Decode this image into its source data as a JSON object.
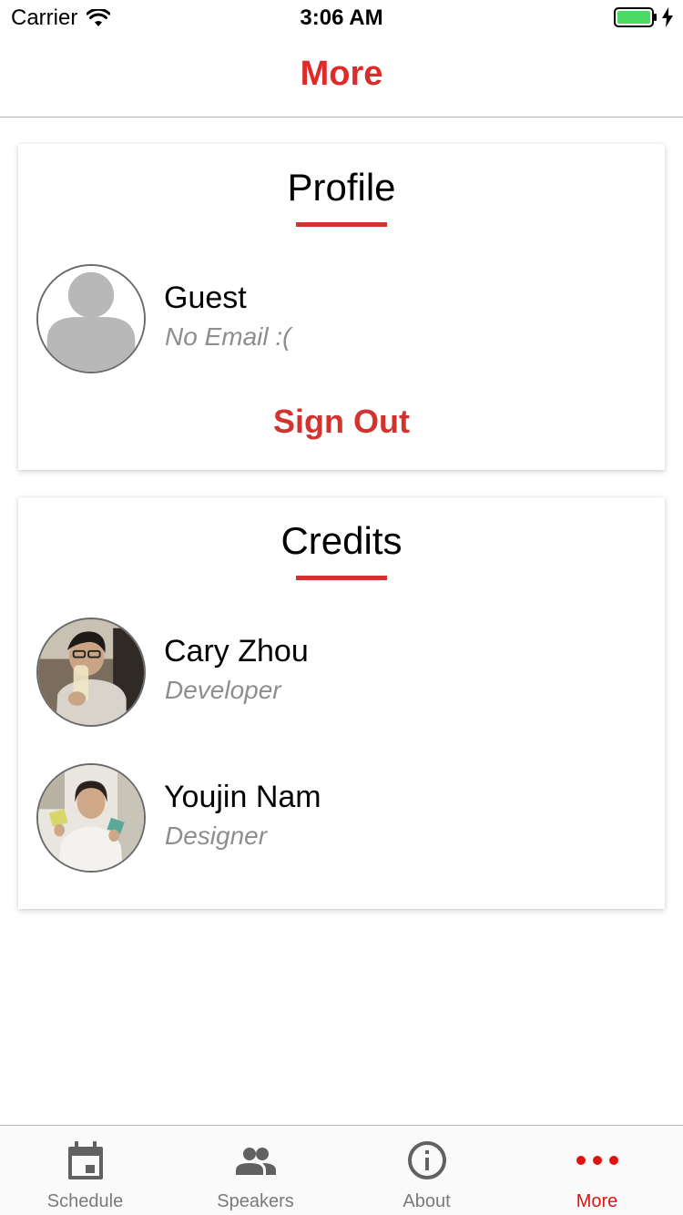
{
  "status_bar": {
    "carrier": "Carrier",
    "time": "3:06 AM",
    "battery_level": 1.0
  },
  "nav": {
    "title": "More"
  },
  "profile_card": {
    "title": "Profile",
    "name": "Guest",
    "email": "No Email :(",
    "sign_out_label": "Sign Out"
  },
  "credits_card": {
    "title": "Credits",
    "people": [
      {
        "name": "Cary Zhou",
        "role": "Developer"
      },
      {
        "name": "Youjin Nam",
        "role": "Designer"
      }
    ]
  },
  "tabs": [
    {
      "label": "Schedule",
      "icon": "calendar-icon",
      "active": false
    },
    {
      "label": "Speakers",
      "icon": "people-icon",
      "active": false
    },
    {
      "label": "About",
      "icon": "info-icon",
      "active": false
    },
    {
      "label": "More",
      "icon": "more-dots-icon",
      "active": true
    }
  ],
  "colors": {
    "accent": "#e02a2a",
    "underline": "#d2332f",
    "tab_inactive": "#7a7a7a",
    "tab_active": "#e31212",
    "subtext": "#8e8e8e"
  }
}
